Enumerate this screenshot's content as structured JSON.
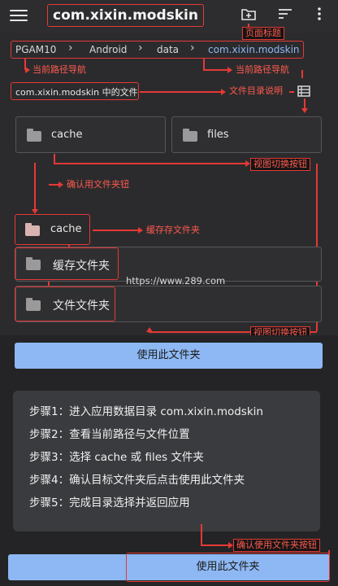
{
  "app": {
    "title": "com.xixin.modskin",
    "url": "https://www.289.com"
  },
  "breadcrumb": [
    "PGAM10",
    "Android",
    "data",
    "com.xixin.modskin"
  ],
  "subtitle": "com.xixin.modskin 中的文件",
  "grid": [
    {
      "name": "cache"
    },
    {
      "name": "files"
    }
  ],
  "list": [
    {
      "name": "cache"
    },
    {
      "name": "缓存文件夹"
    },
    {
      "name": "文件文件夹"
    }
  ],
  "buttons": {
    "use_folder_top": "使用此文件夹",
    "use_folder_bottom": "使用此文件夹"
  },
  "steps": [
    "步骤1：进入应用数据目录 com.xixin.modskin",
    "步骤2：查看当前路径与文件位置",
    "步骤3：选择 cache 或 files 文件夹",
    "步骤4：确认目标文件夹后点击使用此文件夹",
    "步骤5：完成目录选择并返回应用"
  ],
  "annotations": {
    "page_title": "页面标题",
    "crumb_nav_1": "当前路径导航",
    "crumb_nav_2": "当前路径导航",
    "dir_desc": "文件目录说明",
    "view_switch_1": "视图切换按钮",
    "confirm_folder": "确认用文件夹钮",
    "cache_folder": "缓存存文件夹",
    "view_switch_2": "视图切换按钮",
    "confirm_use_btn": "确认使用文件夹按钮"
  },
  "colors": {
    "accent_blue": "#8db8f3",
    "annotation_red": "#e53935",
    "background": "#2b2b2d"
  }
}
